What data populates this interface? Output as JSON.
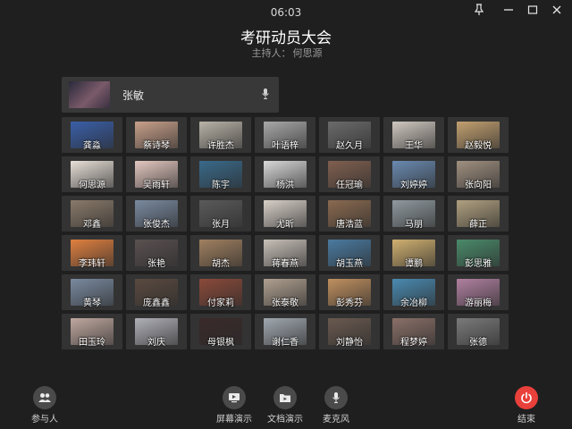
{
  "header": {
    "time": "06:03",
    "title": "考研动员大会",
    "host_label": "主持人：",
    "host_name": "何思源"
  },
  "window_controls": [
    {
      "name": "pin-icon"
    },
    {
      "name": "minimize-icon"
    },
    {
      "name": "maximize-icon"
    },
    {
      "name": "close-icon"
    }
  ],
  "speaker": {
    "name": "张敏",
    "icon": "microphone-icon"
  },
  "participants": [
    {
      "name": "龚淼",
      "color": "#3a5fa8"
    },
    {
      "name": "蔡诗琴",
      "color": "#c8a08a"
    },
    {
      "name": "许胜杰",
      "color": "#b9b3a8"
    },
    {
      "name": "叶语梓",
      "color": "#a8a8a8"
    },
    {
      "name": "赵久月",
      "color": "#6b6b6b"
    },
    {
      "name": "王华",
      "color": "#d0c8c0"
    },
    {
      "name": "赵毅悦",
      "color": "#c2a070"
    },
    {
      "name": "何思源",
      "color": "#e8e0d8"
    },
    {
      "name": "吴雨轩",
      "color": "#e4c8c0"
    },
    {
      "name": "陈宇",
      "color": "#3a6a8a"
    },
    {
      "name": "杨洪",
      "color": "#d8d8d8"
    },
    {
      "name": "任冠瑜",
      "color": "#806050"
    },
    {
      "name": "刘婷婷",
      "color": "#6a8ab0"
    },
    {
      "name": "张向阳",
      "color": "#a09080"
    },
    {
      "name": "邓鑫",
      "color": "#8a7a6a"
    },
    {
      "name": "张俊杰",
      "color": "#7a8aa0"
    },
    {
      "name": "张月",
      "color": "#5a5a5a"
    },
    {
      "name": "尤昕",
      "color": "#d8d0c8"
    },
    {
      "name": "唐浩蓝",
      "color": "#8a6a50"
    },
    {
      "name": "马朋",
      "color": "#909aa0"
    },
    {
      "name": "薛正",
      "color": "#b0a080"
    },
    {
      "name": "李玮轩",
      "color": "#e08040"
    },
    {
      "name": "张艳",
      "color": "#5a5050"
    },
    {
      "name": "胡杰",
      "color": "#a08060"
    },
    {
      "name": "蒋春燕",
      "color": "#c8c0b8"
    },
    {
      "name": "胡玉燕",
      "color": "#4a7aa0"
    },
    {
      "name": "谭鹏",
      "color": "#d0b070"
    },
    {
      "name": "彭思雅",
      "color": "#4a8a6a"
    },
    {
      "name": "黄琴",
      "color": "#7a8aa0"
    },
    {
      "name": "庞鑫鑫",
      "color": "#5a4a40"
    },
    {
      "name": "付家莉",
      "color": "#8a4a3a"
    },
    {
      "name": "张泰敬",
      "color": "#b0a090"
    },
    {
      "name": "彭秀芬",
      "color": "#c09060"
    },
    {
      "name": "余冶柳",
      "color": "#4a8ab0"
    },
    {
      "name": "游丽梅",
      "color": "#b080a0"
    },
    {
      "name": "田玉玲",
      "color": "#c0a8a0"
    },
    {
      "name": "刘庆",
      "color": "#b0b0b8"
    },
    {
      "name": "母银枫",
      "color": "#3a2a2a"
    },
    {
      "name": "谢仁香",
      "color": "#a0a8b0"
    },
    {
      "name": "刘静怡",
      "color": "#6a5a50"
    },
    {
      "name": "程梦婷",
      "color": "#8a7068"
    },
    {
      "name": "张德",
      "color": "#7a7a7a"
    }
  ],
  "bottom": {
    "participants_label": "参与人",
    "screen_share_label": "屏幕演示",
    "doc_share_label": "文档演示",
    "mic_label": "麦克风",
    "end_label": "结束"
  },
  "colors": {
    "background": "#1f1f1f",
    "tile": "#333333",
    "end_button": "#e8403a"
  }
}
